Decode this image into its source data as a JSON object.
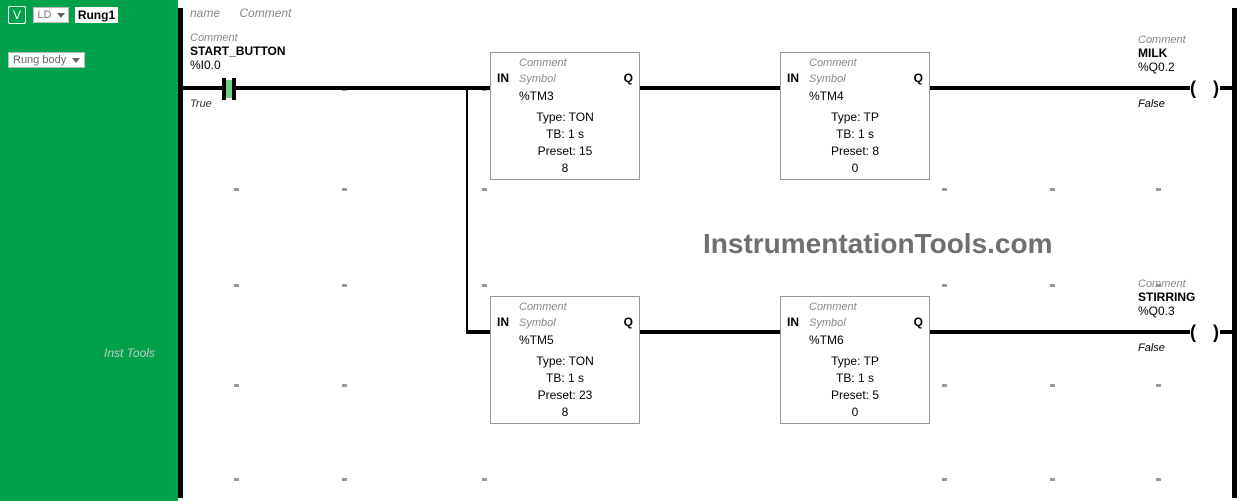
{
  "sidebar": {
    "lang_dropdown": "LD",
    "rung_name": "Rung1",
    "view_dropdown": "Rung body",
    "inst_tools": "Inst Tools"
  },
  "header": {
    "name_label": "name",
    "comment_label": "Comment"
  },
  "start_contact": {
    "comment_label": "Comment",
    "symbol": "START_BUTTON",
    "address": "%I0.0",
    "state": "True"
  },
  "blocks": {
    "tm3": {
      "comment_label": "Comment",
      "symbol_label": "Symbol",
      "symbol": "%TM3",
      "in": "IN",
      "q": "Q",
      "type": "Type: TON",
      "tb": "TB: 1 s",
      "preset": "Preset: 15",
      "value": "8"
    },
    "tm4": {
      "comment_label": "Comment",
      "symbol_label": "Symbol",
      "symbol": "%TM4",
      "in": "IN",
      "q": "Q",
      "type": "Type: TP",
      "tb": "TB: 1 s",
      "preset": "Preset: 8",
      "value": "0"
    },
    "tm5": {
      "comment_label": "Comment",
      "symbol_label": "Symbol",
      "symbol": "%TM5",
      "in": "IN",
      "q": "Q",
      "type": "Type: TON",
      "tb": "TB: 1 s",
      "preset": "Preset: 23",
      "value": "8"
    },
    "tm6": {
      "comment_label": "Comment",
      "symbol_label": "Symbol",
      "symbol": "%TM6",
      "in": "IN",
      "q": "Q",
      "type": "Type: TP",
      "tb": "TB: 1 s",
      "preset": "Preset: 5",
      "value": "0"
    }
  },
  "outputs": {
    "milk": {
      "comment_label": "Comment",
      "symbol": "MILK",
      "address": "%Q0.2",
      "state": "False"
    },
    "stirring": {
      "comment_label": "Comment",
      "symbol": "STIRRING",
      "address": "%Q0.3",
      "state": "False"
    }
  },
  "watermark": "InstrumentationTools.com",
  "chart_data": {
    "type": "ladder_diagram",
    "rung_name": "Rung1",
    "language": "LD",
    "rungs": [
      {
        "input": {
          "type": "NO_contact",
          "symbol": "START_BUTTON",
          "address": "%I0.0",
          "state": true
        },
        "branches": [
          {
            "blocks": [
              {
                "ref": "%TM3",
                "type": "TON",
                "tb_s": 1,
                "preset": 15,
                "elapsed": 8
              },
              {
                "ref": "%TM4",
                "type": "TP",
                "tb_s": 1,
                "preset": 8,
                "elapsed": 0
              }
            ],
            "output": {
              "type": "coil",
              "symbol": "MILK",
              "address": "%Q0.2",
              "state": false
            }
          },
          {
            "blocks": [
              {
                "ref": "%TM5",
                "type": "TON",
                "tb_s": 1,
                "preset": 23,
                "elapsed": 8
              },
              {
                "ref": "%TM6",
                "type": "TP",
                "tb_s": 1,
                "preset": 5,
                "elapsed": 0
              }
            ],
            "output": {
              "type": "coil",
              "symbol": "STIRRING",
              "address": "%Q0.3",
              "state": false
            }
          }
        ]
      }
    ]
  }
}
